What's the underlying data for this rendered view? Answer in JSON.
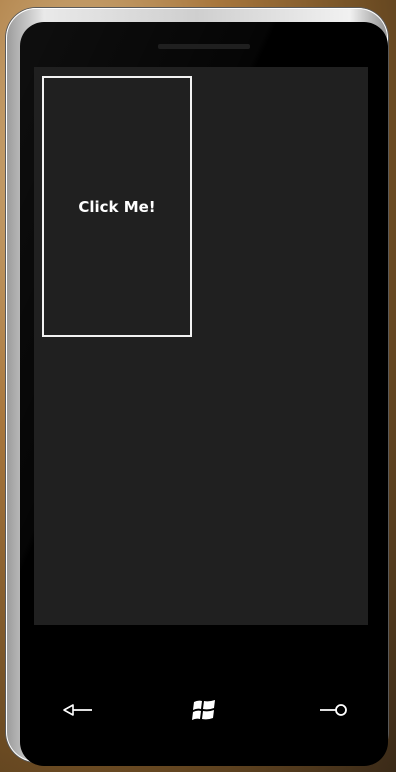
{
  "screen": {
    "button_label": "Click Me!"
  },
  "hardware_buttons": {
    "back": "back-arrow-icon",
    "start": "windows-logo-icon",
    "search": "search-icon"
  },
  "colors": {
    "screen_background": "#202020",
    "button_border": "#f2f2f2",
    "button_text": "#ffffff"
  }
}
